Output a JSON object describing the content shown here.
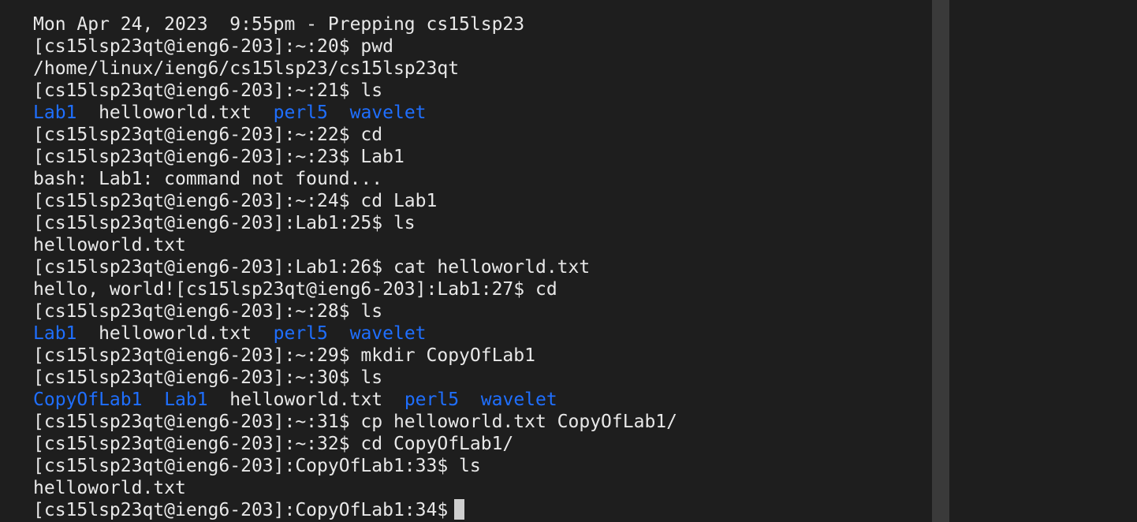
{
  "terminal": {
    "lines": [
      [
        {
          "text": "Mon Apr 24, 2023  9:55pm - Prepping cs15lsp23",
          "kind": "plain"
        }
      ],
      [
        {
          "text": "[cs15lsp23qt@ieng6-203]:~:20$ pwd",
          "kind": "plain"
        }
      ],
      [
        {
          "text": "/home/linux/ieng6/cs15lsp23/cs15lsp23qt",
          "kind": "plain"
        }
      ],
      [
        {
          "text": "[cs15lsp23qt@ieng6-203]:~:21$ ls",
          "kind": "plain"
        }
      ],
      [
        {
          "text": "Lab1",
          "kind": "dir"
        },
        {
          "text": "  helloworld.txt  ",
          "kind": "plain"
        },
        {
          "text": "perl5",
          "kind": "dir"
        },
        {
          "text": "  ",
          "kind": "plain"
        },
        {
          "text": "wavelet",
          "kind": "dir"
        }
      ],
      [
        {
          "text": "[cs15lsp23qt@ieng6-203]:~:22$ cd",
          "kind": "plain"
        }
      ],
      [
        {
          "text": "[cs15lsp23qt@ieng6-203]:~:23$ Lab1",
          "kind": "plain"
        }
      ],
      [
        {
          "text": "bash: Lab1: command not found...",
          "kind": "plain"
        }
      ],
      [
        {
          "text": "[cs15lsp23qt@ieng6-203]:~:24$ cd Lab1",
          "kind": "plain"
        }
      ],
      [
        {
          "text": "[cs15lsp23qt@ieng6-203]:Lab1:25$ ls",
          "kind": "plain"
        }
      ],
      [
        {
          "text": "helloworld.txt",
          "kind": "plain"
        }
      ],
      [
        {
          "text": "[cs15lsp23qt@ieng6-203]:Lab1:26$ cat helloworld.txt",
          "kind": "plain"
        }
      ],
      [
        {
          "text": "hello, world![cs15lsp23qt@ieng6-203]:Lab1:27$ cd",
          "kind": "plain"
        }
      ],
      [
        {
          "text": "[cs15lsp23qt@ieng6-203]:~:28$ ls",
          "kind": "plain"
        }
      ],
      [
        {
          "text": "Lab1",
          "kind": "dir"
        },
        {
          "text": "  helloworld.txt  ",
          "kind": "plain"
        },
        {
          "text": "perl5",
          "kind": "dir"
        },
        {
          "text": "  ",
          "kind": "plain"
        },
        {
          "text": "wavelet",
          "kind": "dir"
        }
      ],
      [
        {
          "text": "[cs15lsp23qt@ieng6-203]:~:29$ mkdir CopyOfLab1",
          "kind": "plain"
        }
      ],
      [
        {
          "text": "[cs15lsp23qt@ieng6-203]:~:30$ ls",
          "kind": "plain"
        }
      ],
      [
        {
          "text": "CopyOfLab1",
          "kind": "dir"
        },
        {
          "text": "  ",
          "kind": "plain"
        },
        {
          "text": "Lab1",
          "kind": "dir"
        },
        {
          "text": "  helloworld.txt  ",
          "kind": "plain"
        },
        {
          "text": "perl5",
          "kind": "dir"
        },
        {
          "text": "  ",
          "kind": "plain"
        },
        {
          "text": "wavelet",
          "kind": "dir"
        }
      ],
      [
        {
          "text": "[cs15lsp23qt@ieng6-203]:~:31$ cp helloworld.txt CopyOfLab1/",
          "kind": "plain"
        }
      ],
      [
        {
          "text": "[cs15lsp23qt@ieng6-203]:~:32$ cd CopyOfLab1/",
          "kind": "plain"
        }
      ],
      [
        {
          "text": "[cs15lsp23qt@ieng6-203]:CopyOfLab1:33$ ls",
          "kind": "plain"
        }
      ],
      [
        {
          "text": "helloworld.txt",
          "kind": "plain"
        }
      ],
      [
        {
          "text": "[cs15lsp23qt@ieng6-203]:CopyOfLab1:34$",
          "kind": "plain"
        }
      ]
    ]
  },
  "colors": {
    "background": "#1e1e1e",
    "text": "#e8e8e8",
    "directory": "#1f6fff",
    "scrollbar": "#3a3a3a",
    "cursor": "#cfcfcf"
  }
}
